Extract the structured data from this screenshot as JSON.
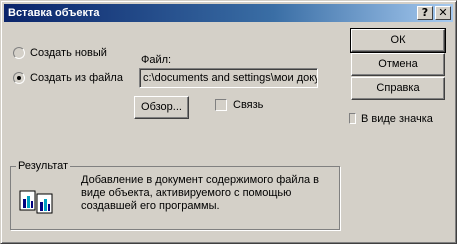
{
  "window": {
    "title": "Вставка объекта",
    "help_btn": "?",
    "close_btn": "✕"
  },
  "options": {
    "create_new_label": "Создать новый",
    "create_from_file_label": "Создать из файла",
    "selected": "create_from_file"
  },
  "file": {
    "label": "Файл:",
    "path": "c:\\documents and settings\\мои докуме"
  },
  "buttons": {
    "browse": "Обзор...",
    "ok": "ОК",
    "cancel": "Отмена",
    "help": "Справка"
  },
  "link_checkbox": {
    "label": "Связь",
    "checked": false
  },
  "as_icon_checkbox": {
    "label": "В виде значка",
    "checked": false
  },
  "result": {
    "title": "Результат",
    "text": "Добавление в документ содержимого файла в виде объекта, активируемого с помощью создавшей его программы."
  }
}
